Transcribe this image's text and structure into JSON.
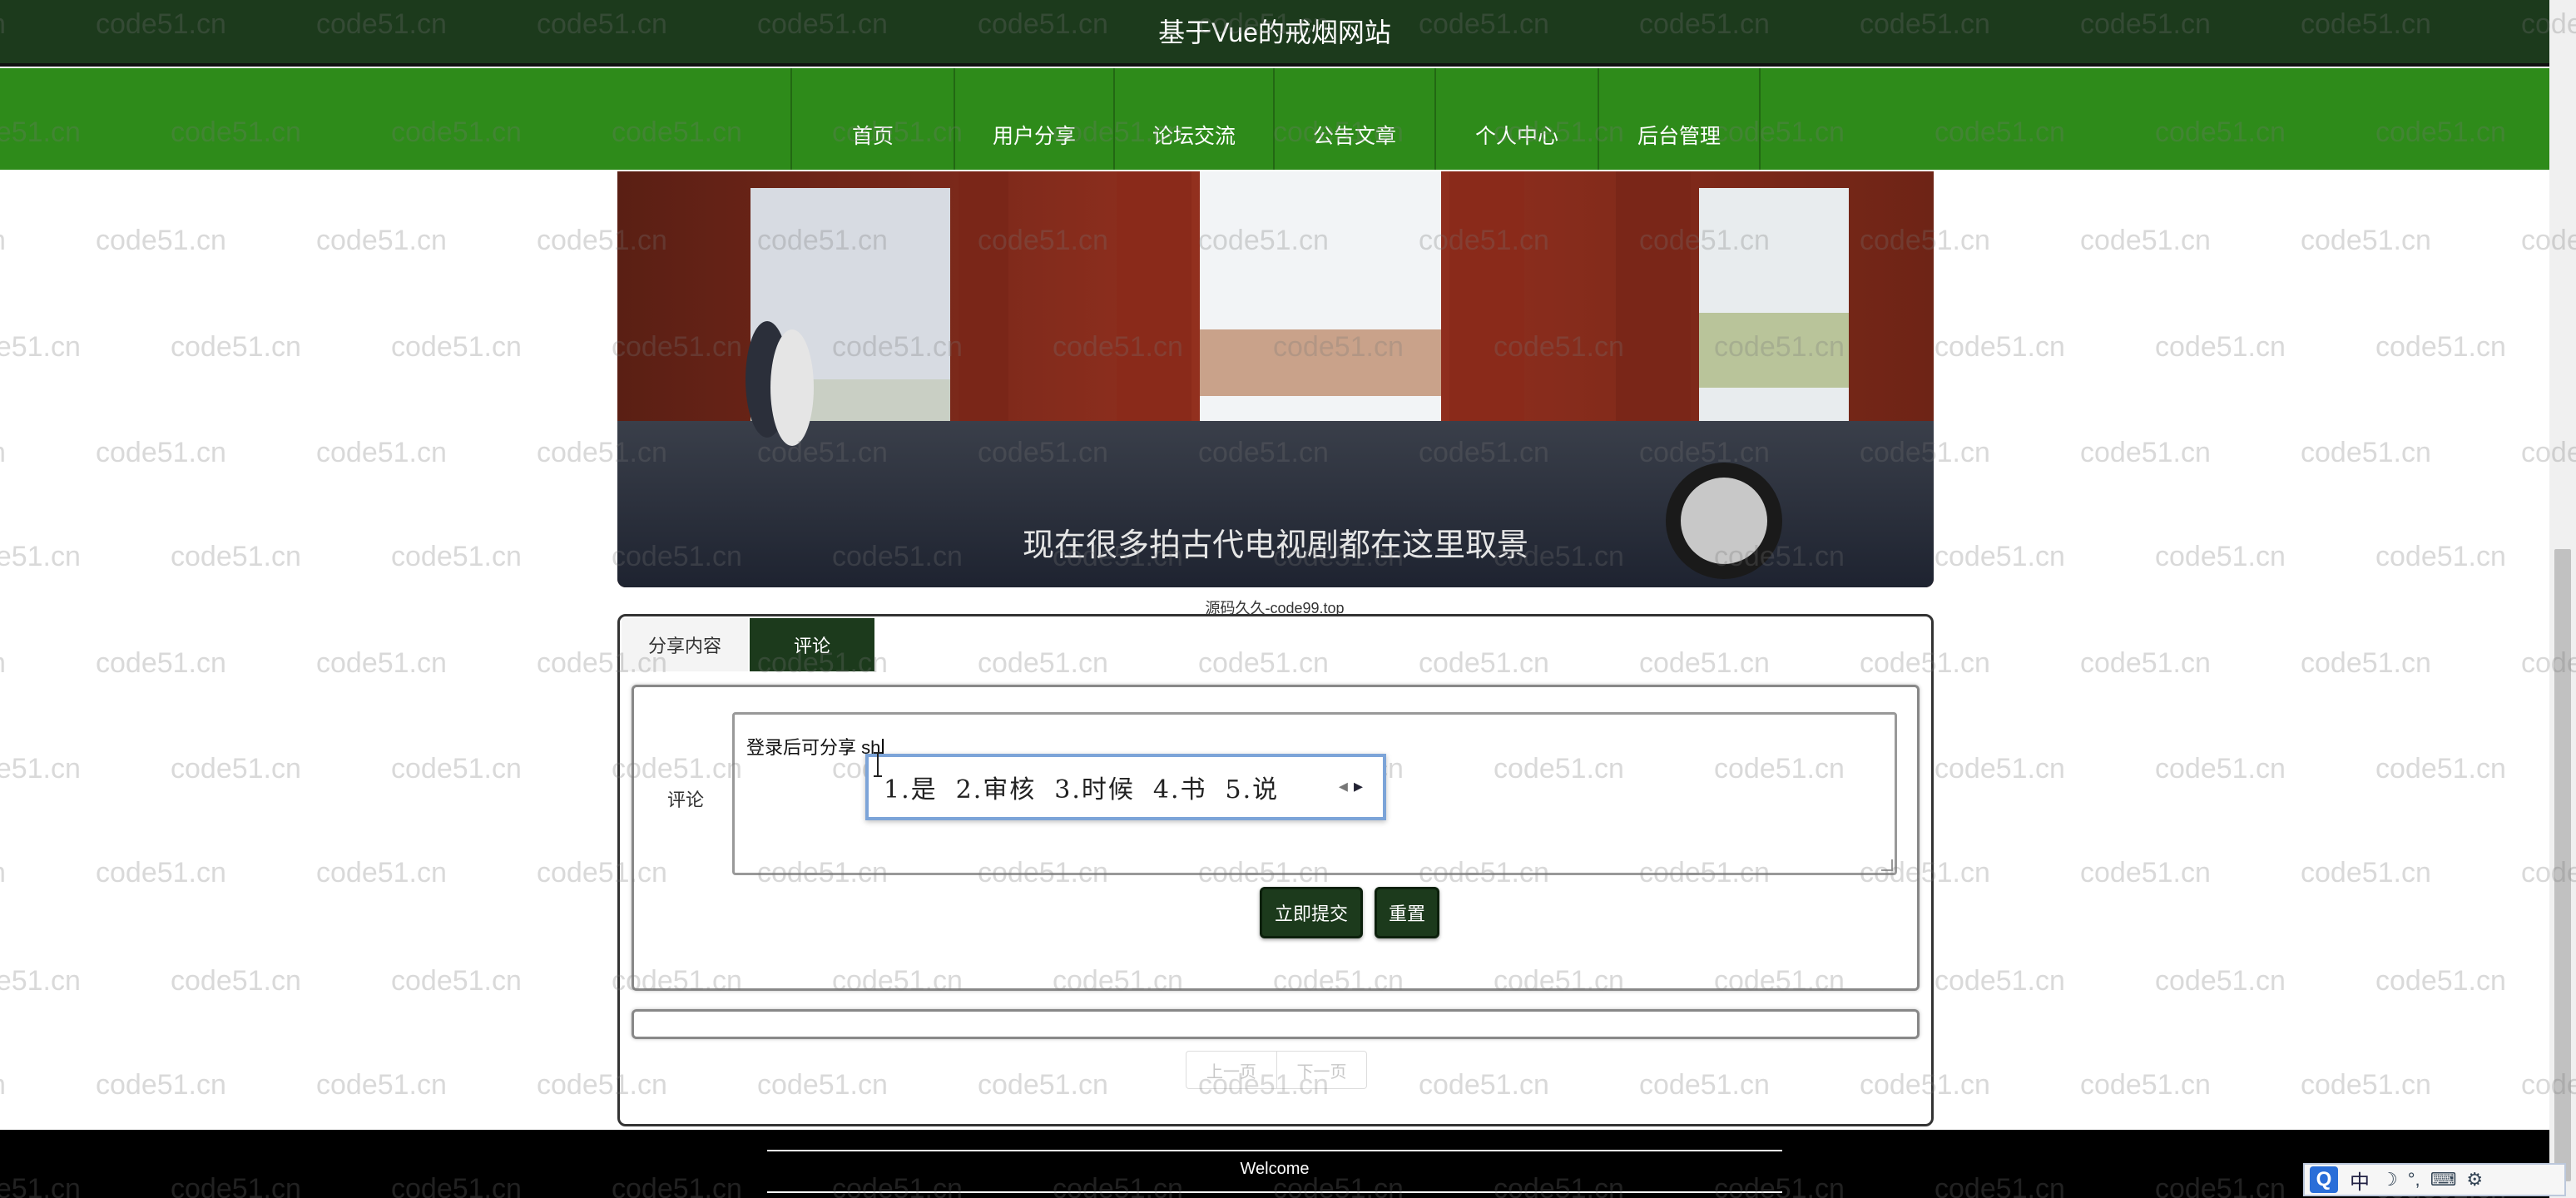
{
  "header": {
    "title": "基于Vue的戒烟网站"
  },
  "nav": {
    "items": [
      {
        "label": "首页"
      },
      {
        "label": "用户分享"
      },
      {
        "label": "论坛交流"
      },
      {
        "label": "公告文章"
      },
      {
        "label": "个人中心"
      },
      {
        "label": "后台管理"
      }
    ]
  },
  "banner": {
    "subtitle": "现在很多拍古代电视剧都在这里取景",
    "caption": "源码久久-code99.top"
  },
  "tabs": [
    {
      "label": "分享内容",
      "active": false
    },
    {
      "label": "评论",
      "active": true
    }
  ],
  "comment_form": {
    "label": "评论",
    "value": "登录后可分享 sh",
    "submit_label": "立即提交",
    "reset_label": "重置"
  },
  "pager": {
    "prev_label": "上一页",
    "next_label": "下一页"
  },
  "ime_popup": {
    "candidates": [
      "1.是",
      "2.审核",
      "3.时候",
      "4.书",
      "5.说"
    ]
  },
  "ime_status": {
    "badge": "Q",
    "lang": "中"
  },
  "footer": {
    "text": "Welcome"
  },
  "watermark": {
    "text": "code51.cn"
  },
  "colors": {
    "header_bg": "#1c3a1c",
    "nav_bg": "#2e8b1a",
    "button_bg": "#1c3a1c",
    "footer_bg": "#000000"
  },
  "icons": [
    "mouse-cursor-icon",
    "resize-grip-icon",
    "ime-arrow-left-icon",
    "ime-arrow-right-icon"
  ]
}
